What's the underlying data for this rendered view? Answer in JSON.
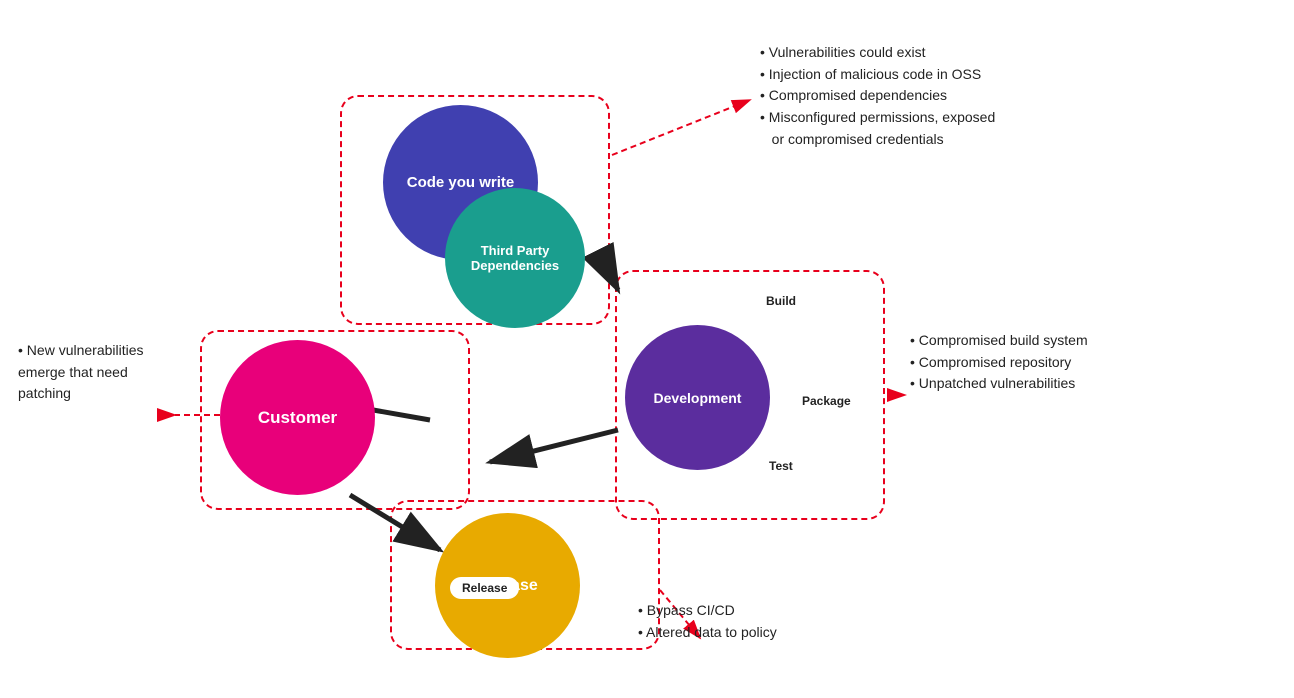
{
  "circles": {
    "code": {
      "label": "Code you write"
    },
    "third_party": {
      "label": "Third Party\nDependencies"
    },
    "customer": {
      "label": "Customer"
    },
    "development": {
      "label": "Development"
    },
    "release": {
      "label": "Release"
    }
  },
  "small_labels": {
    "build": "Build",
    "package": "Package",
    "test": "Test"
  },
  "text_blocks": {
    "top_right": {
      "items": [
        "Vulnerabilities could exist",
        "Injection of malicious code in OSS",
        "Compromised dependencies",
        "Misconfigured permissions, exposed\n    or compromised credentials"
      ]
    },
    "middle_left": {
      "items": [
        "New vulnerabilities\nemerge that need\npatching"
      ]
    },
    "right_middle": {
      "items": [
        "Compromised build system",
        "Compromised repository",
        "Unpatched vulnerabilities"
      ]
    },
    "bottom_center": {
      "items": [
        "Bypass CI/CD",
        "Altered data to policy"
      ]
    }
  }
}
